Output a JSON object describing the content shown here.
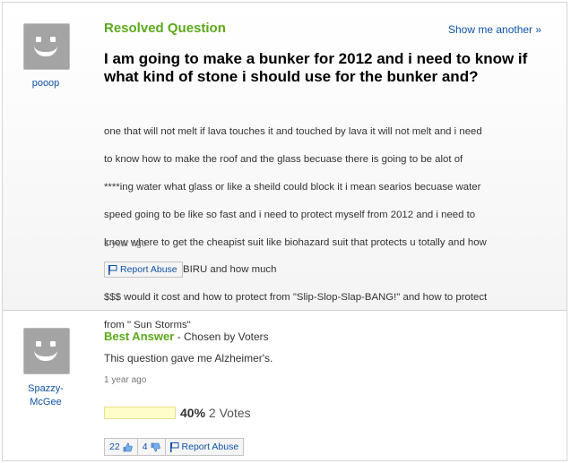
{
  "question": {
    "status": "Resolved Question",
    "show_another": "Show me another »",
    "asker": "pooop",
    "title": "I am going to make a bunker for 2012 and i need to know if what kind of stone i should use for the bunker and?",
    "body_lines": [
      "one that will not melt if lava touches it and touched by lava it will not melt and i need",
      "to know how to make the roof and the glass becuase there is going to be alot of",
      "****ing water what glass or like a sheild could block it i mean searios becuase water",
      "speed going to be like so fast and i need to protect myself from 2012 and i need to",
      "know where to get the cheapist suit like biohazard suit that protects u totally and how",
      "to protect from NIBIRU and how much",
      "$$$ would it cost and how to protect from \"Slip-Slop-Slap-BANG!\" and how to protect",
      "from \" Sun Storms\""
    ],
    "time": "1 year ago",
    "report_abuse": "Report Abuse"
  },
  "answer": {
    "label": "Best Answer",
    "chosen_by": " - Chosen by Voters",
    "answerer_line1": "Spazzy-",
    "answerer_line2": "McGee",
    "text": "This question gave me Alzheimer's.",
    "time": "1 year ago",
    "vote_percent": "40%",
    "vote_percent_value": 40,
    "vote_count": "2 Votes",
    "thumbs_up": "22",
    "thumbs_down": "4",
    "report_abuse": "Report Abuse"
  },
  "colors": {
    "green": "#5caa1b",
    "link": "#0e53a7",
    "vote_bar": "#ffffcc"
  },
  "icons": {
    "avatar": "default-smiley-avatar",
    "flag": "flag-icon",
    "thumbs_up": "thumbs-up-icon",
    "thumbs_down": "thumbs-down-icon"
  }
}
